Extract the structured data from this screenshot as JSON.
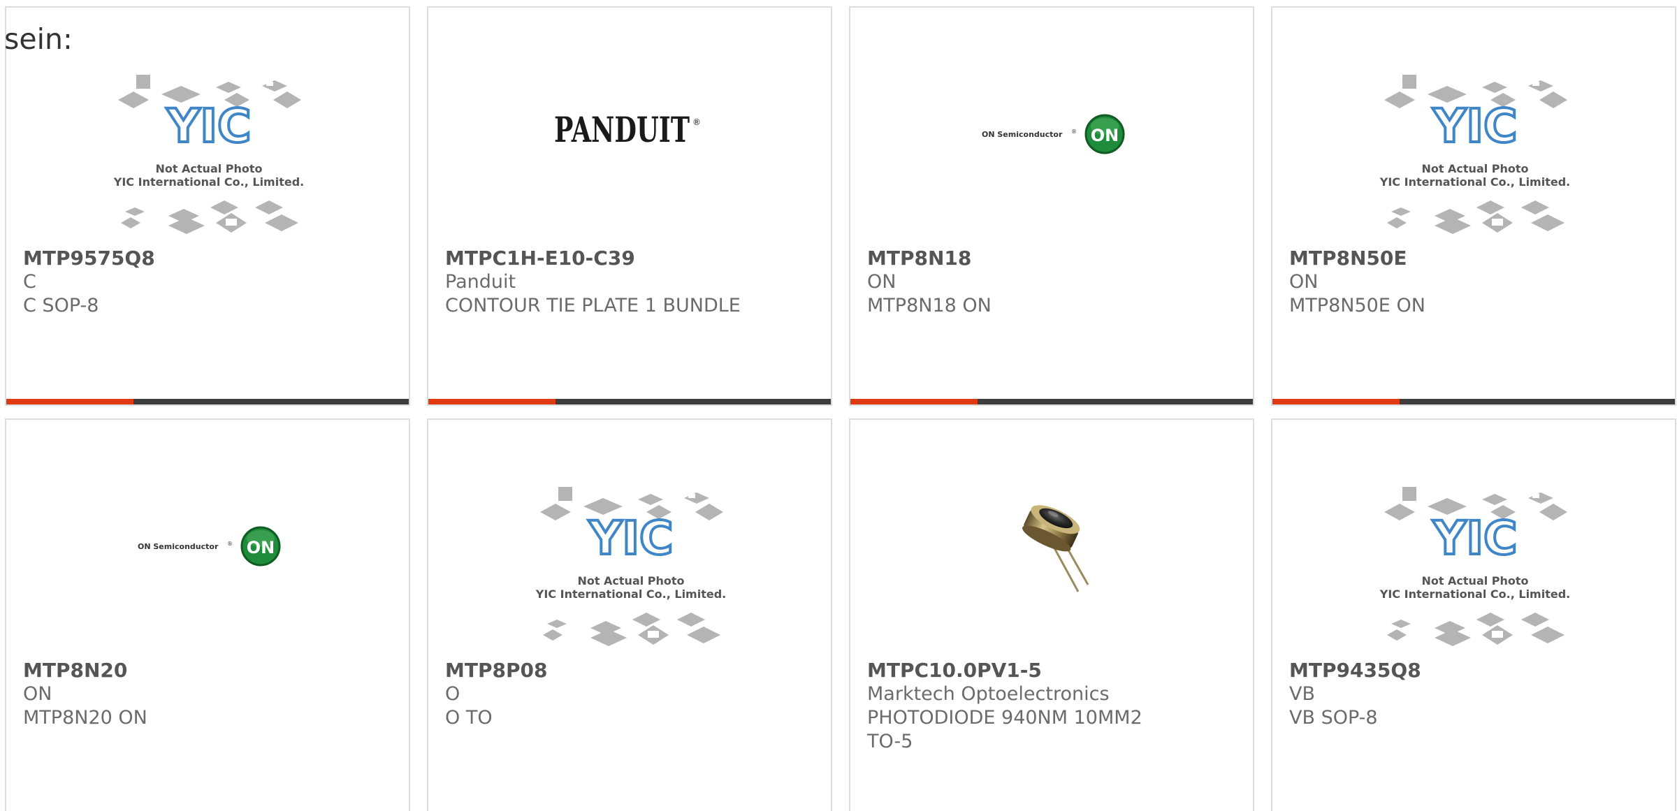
{
  "lead_text": "sein:",
  "brand_colors": {
    "accent": "#e03a12",
    "bar": "#3d3d3d",
    "yic_blue": "#3f86c9",
    "on_green": "#1e8c3a"
  },
  "cards": [
    {
      "part": "MTP9575Q8",
      "manufacturer": "C",
      "description": "C SOP-8",
      "image": "yic-placeholder",
      "placeholder_line1": "Not Actual Photo",
      "placeholder_line2": "YIC International Co., Limited.",
      "placeholder_logo": "YIC"
    },
    {
      "part": "MTPC1H-E10-C39",
      "manufacturer": "Panduit",
      "description": "CONTOUR TIE PLATE 1 BUNDLE",
      "image": "panduit-logo",
      "logo_text": "PANDUIT",
      "logo_mark": "®"
    },
    {
      "part": "MTP8N18",
      "manufacturer": "ON",
      "description": "MTP8N18 ON",
      "image": "on-semi-logo",
      "logo_text": "ON Semiconductor",
      "logo_mark": "®",
      "badge_text": "ON"
    },
    {
      "part": "MTP8N50E",
      "manufacturer": "ON",
      "description": "MTP8N50E ON",
      "image": "yic-placeholder",
      "placeholder_line1": "Not Actual Photo",
      "placeholder_line2": "YIC International Co., Limited.",
      "placeholder_logo": "YIC"
    },
    {
      "part": "MTP8N20",
      "manufacturer": "ON",
      "description": "MTP8N20 ON",
      "image": "on-semi-logo",
      "logo_text": "ON Semiconductor",
      "logo_mark": "®",
      "badge_text": "ON"
    },
    {
      "part": "MTP8P08",
      "manufacturer": "O",
      "description": "O TO",
      "image": "yic-placeholder",
      "placeholder_line1": "Not Actual Photo",
      "placeholder_line2": "YIC International Co., Limited.",
      "placeholder_logo": "YIC"
    },
    {
      "part": "MTPC10.0PV1-5",
      "manufacturer": "Marktech Optoelectronics",
      "description": "PHOTODIODE 940NM 10MM2 TO-5",
      "image": "photodiode-photo"
    },
    {
      "part": "MTP9435Q8",
      "manufacturer": "VB",
      "description": "VB SOP-8",
      "image": "yic-placeholder",
      "placeholder_line1": "Not Actual Photo",
      "placeholder_line2": "YIC International Co., Limited.",
      "placeholder_logo": "YIC"
    }
  ]
}
